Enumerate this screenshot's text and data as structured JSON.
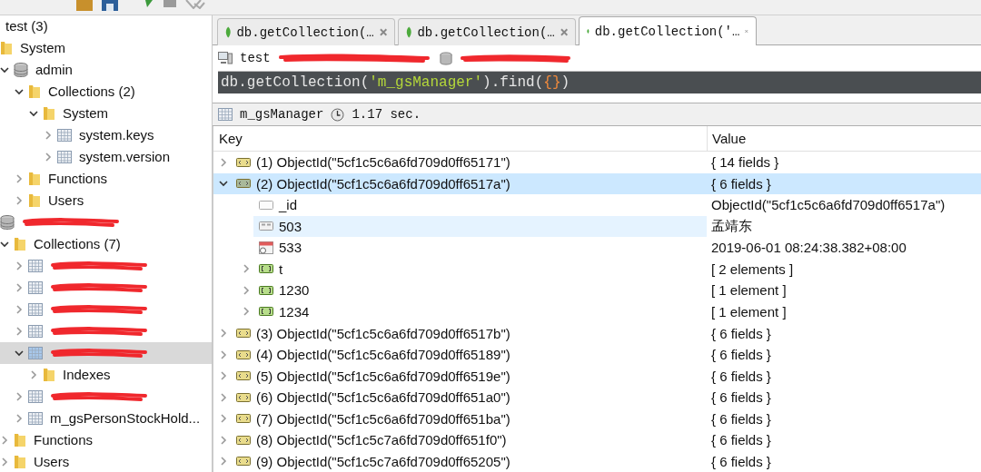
{
  "tree": [
    {
      "label": "test (3)",
      "selected": false,
      "children": [
        {
          "kind": "folder",
          "label": "System",
          "selected": false
        },
        {
          "kind": "database",
          "label": "admin",
          "expanded": true,
          "selected": false,
          "children": [
            {
              "kind": "folder",
              "label": "Collections (2)",
              "expanded": true,
              "selected": false,
              "children": [
                {
                  "kind": "folder",
                  "label": "System",
                  "expanded": true,
                  "selected": false,
                  "children": [
                    {
                      "kind": "collection",
                      "label": "system.keys",
                      "expanded": false,
                      "selected": false
                    },
                    {
                      "kind": "collection",
                      "label": "system.version",
                      "expanded": false,
                      "selected": false
                    }
                  ]
                }
              ]
            },
            {
              "kind": "folder",
              "label": "Functions",
              "expanded": false,
              "selected": false
            },
            {
              "kind": "folder",
              "label": "Users",
              "expanded": false,
              "selected": false
            }
          ]
        }
      ]
    },
    {
      "kind": "database",
      "redacted": true,
      "selected": false,
      "children": [
        {
          "kind": "folder",
          "label": "Collections (7)",
          "expanded": true,
          "selected": false,
          "children": [
            {
              "kind": "collection",
              "redacted": true,
              "expanded": false,
              "selected": false
            },
            {
              "kind": "collection",
              "redacted": true,
              "expanded": false,
              "selected": false
            },
            {
              "kind": "collection",
              "redacted": true,
              "expanded": false,
              "selected": false
            },
            {
              "kind": "collection",
              "redacted": true,
              "expanded": false,
              "selected": false
            },
            {
              "kind": "collection",
              "redacted": true,
              "expanded": true,
              "selected": true,
              "children": [
                {
                  "kind": "folder",
                  "label": "Indexes",
                  "expanded": false,
                  "selected": false
                }
              ]
            },
            {
              "kind": "collection",
              "redacted": true,
              "expanded": false,
              "selected": false
            },
            {
              "kind": "collection",
              "label": "m_gsPersonStockHold...",
              "expanded": false,
              "selected": false
            }
          ]
        },
        {
          "kind": "folder",
          "label": "Functions",
          "expanded": false,
          "selected": false
        },
        {
          "kind": "folder",
          "label": "Users",
          "expanded": false,
          "selected": false
        }
      ]
    }
  ],
  "tabs": [
    {
      "label": "db.getCollection(…",
      "selected": false
    },
    {
      "label": "db.getCollection(…",
      "selected": false
    },
    {
      "label": "db.getCollection('…",
      "selected": true
    }
  ],
  "connection": {
    "server": "test"
  },
  "query": [
    {
      "kind": "plain",
      "text": "db.getCollection("
    },
    {
      "kind": "string",
      "text": "'m_gsManager'"
    },
    {
      "kind": "plain",
      "text": ").find("
    },
    {
      "kind": "brace",
      "text": "{}"
    },
    {
      "kind": "plain",
      "text": ")"
    }
  ],
  "result_info": {
    "collection": "m_gsManager",
    "time": "1.17 sec."
  },
  "table": {
    "columns": [
      "Key",
      "Value"
    ],
    "rows": [
      {
        "kind": "document",
        "key": "(1) ObjectId(\"5cf1c5c6a6fd709d0ff65171\")",
        "value": "{ 14 fields }",
        "expanded": false,
        "selected": false,
        "hovered": false
      },
      {
        "kind": "document",
        "key": "(2) ObjectId(\"5cf1c5c6a6fd709d0ff6517a\")",
        "value": "{ 6 fields }",
        "expanded": true,
        "selected": true,
        "hovered": false,
        "children": [
          {
            "kind": "objectid",
            "key": "_id",
            "value": "ObjectId(\"5cf1c5c6a6fd709d0ff6517a\")",
            "selected": false,
            "hovered": false
          },
          {
            "kind": "string",
            "key": "503",
            "value": "孟靖东",
            "selected": false,
            "hovered": true
          },
          {
            "kind": "date",
            "key": "533",
            "value": "2019-06-01 08:24:38.382+08:00",
            "selected": false,
            "hovered": false
          },
          {
            "kind": "array",
            "key": "t",
            "value": "[ 2 elements ]",
            "expanded": false,
            "selected": false,
            "hovered": false
          },
          {
            "kind": "array",
            "key": "1230",
            "value": "[ 1 element ]",
            "expanded": false,
            "selected": false,
            "hovered": false
          },
          {
            "kind": "array",
            "key": "1234",
            "value": "[ 1 element ]",
            "expanded": false,
            "selected": false,
            "hovered": false
          }
        ]
      },
      {
        "kind": "document",
        "key": "(3) ObjectId(\"5cf1c5c6a6fd709d0ff6517b\")",
        "value": "{ 6 fields }",
        "expanded": false,
        "selected": false,
        "hovered": false
      },
      {
        "kind": "document",
        "key": "(4) ObjectId(\"5cf1c5c6a6fd709d0ff65189\")",
        "value": "{ 6 fields }",
        "expanded": false,
        "selected": false,
        "hovered": false
      },
      {
        "kind": "document",
        "key": "(5) ObjectId(\"5cf1c5c6a6fd709d0ff6519e\")",
        "value": "{ 6 fields }",
        "expanded": false,
        "selected": false,
        "hovered": false
      },
      {
        "kind": "document",
        "key": "(6) ObjectId(\"5cf1c5c6a6fd709d0ff651a0\")",
        "value": "{ 6 fields }",
        "expanded": false,
        "selected": false,
        "hovered": false
      },
      {
        "kind": "document",
        "key": "(7) ObjectId(\"5cf1c5c6a6fd709d0ff651ba\")",
        "value": "{ 6 fields }",
        "expanded": false,
        "selected": false,
        "hovered": false
      },
      {
        "kind": "document",
        "key": "(8) ObjectId(\"5cf1c5c7a6fd709d0ff651f0\")",
        "value": "{ 6 fields }",
        "expanded": false,
        "selected": false,
        "hovered": false
      },
      {
        "kind": "document",
        "key": "(9) ObjectId(\"5cf1c5c7a6fd709d0ff65205\")",
        "value": "{ 6 fields }",
        "expanded": false,
        "selected": false,
        "hovered": false
      }
    ]
  }
}
